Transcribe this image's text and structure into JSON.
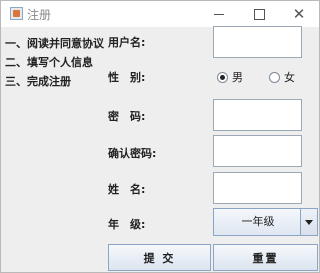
{
  "window": {
    "title": "注册",
    "controls": {
      "minimize": "—",
      "maximize": "☐",
      "close": "✕"
    }
  },
  "steps": [
    "一、阅读并同意协议",
    "二、填写个人信息",
    "三、完成注册"
  ],
  "form": {
    "username_label": "用户名:",
    "gender_label": "性　别:",
    "gender_male": "男",
    "gender_female": "女",
    "gender_selected": "男",
    "password_label": "密　码:",
    "confirm_label": "确认密码:",
    "name_label": "姓　名:",
    "grade_label": "年　级:",
    "grade_selected": "一年级",
    "username_value": "",
    "password_value": "",
    "confirm_value": "",
    "name_value": ""
  },
  "buttons": {
    "submit": "提 交",
    "reset": "重置"
  }
}
